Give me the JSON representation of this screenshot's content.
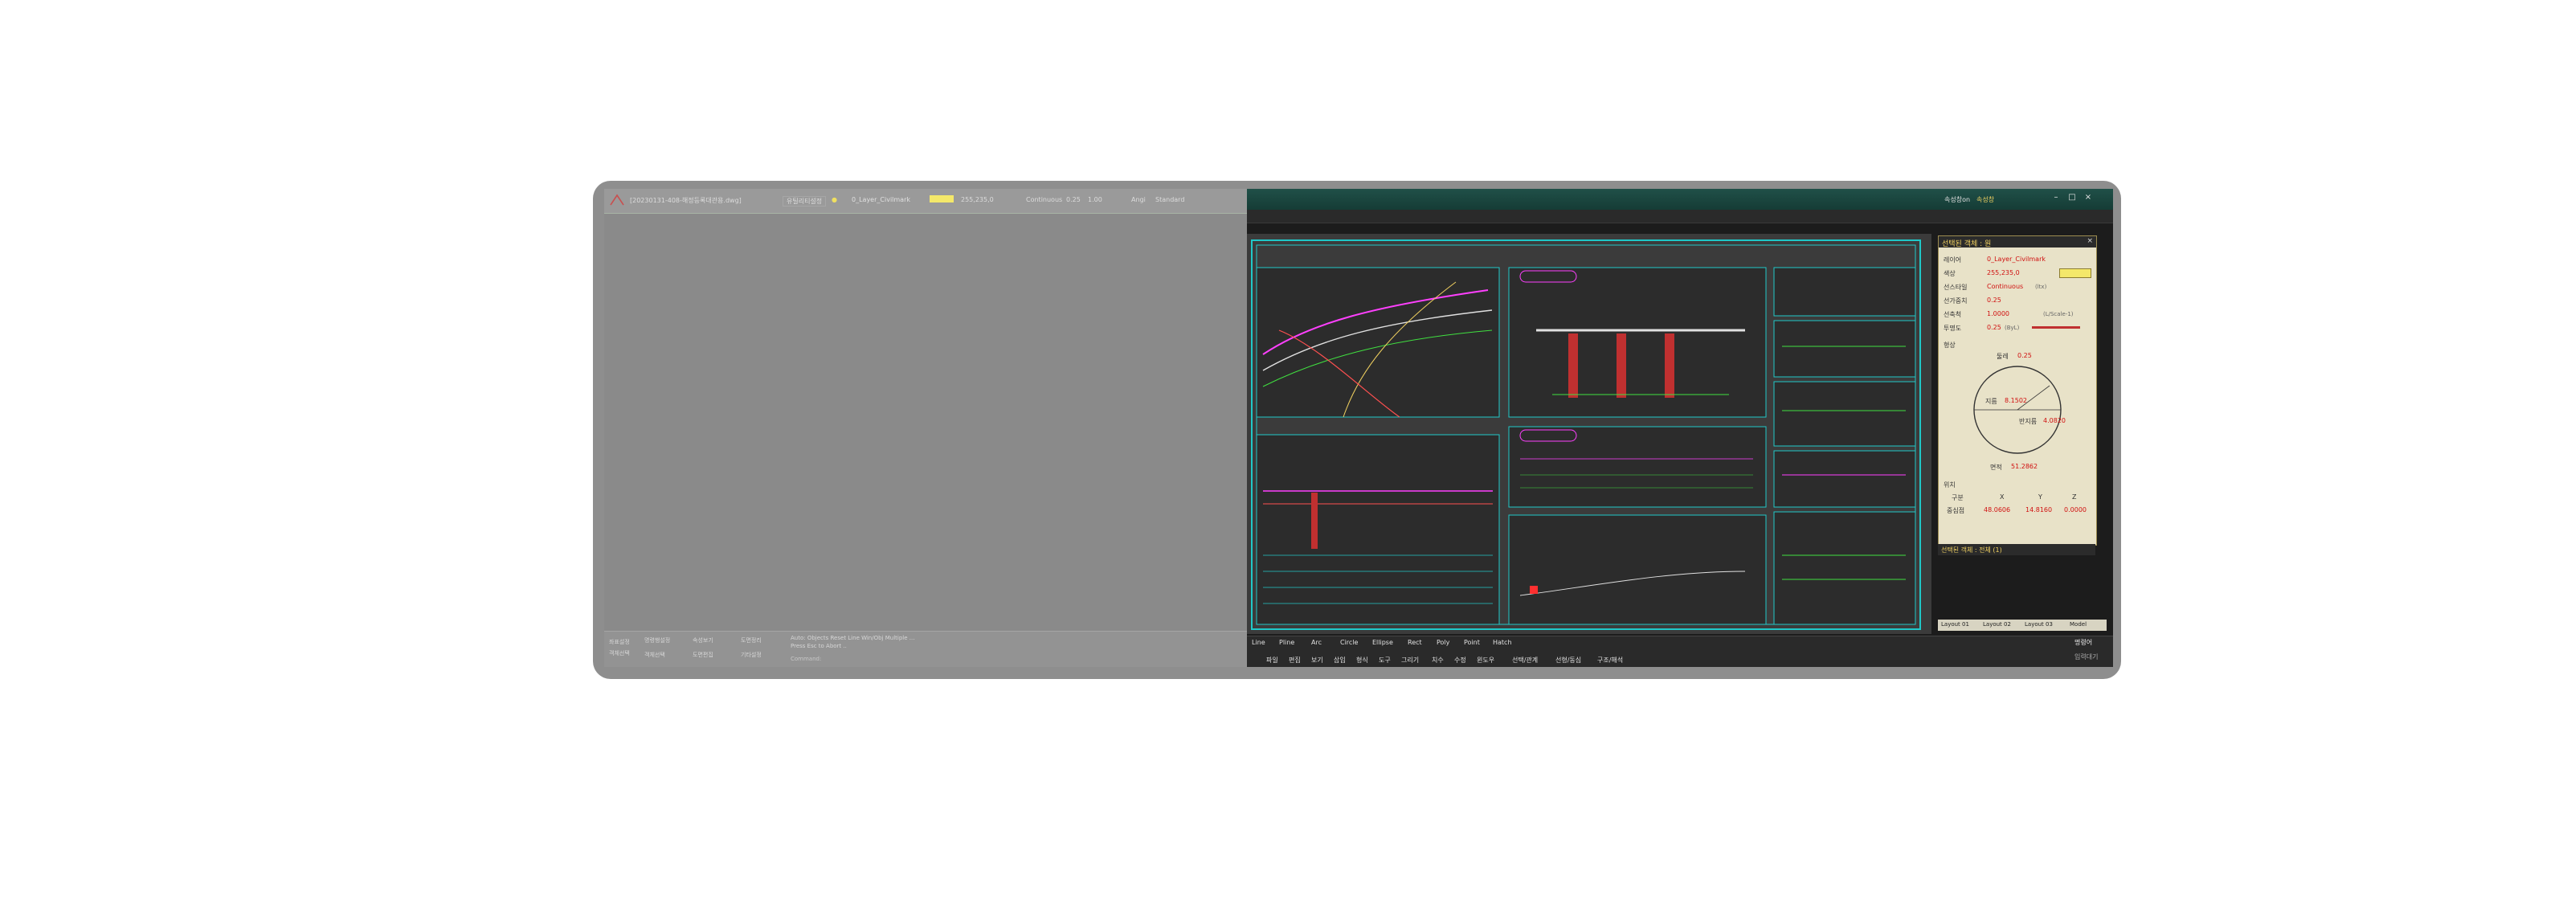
{
  "colors": {
    "accent": "#20c8c8",
    "highlight": "#ff40ff",
    "value_red": "#d01010",
    "swatch": "#f4e86a"
  },
  "left_panel": {
    "title": "[20230131-408-해정등록대관용.dwg]",
    "breadcrumb_tab": "유틸리티설정",
    "layer_name": "0_Layer_Civilmark",
    "color_value": "255,235,0",
    "linetype_name": "Continuous",
    "line_weight": "0.25",
    "line_scale": "1.00",
    "text_style_label": "Angi",
    "text_style": "Standard",
    "cmd_left_top": "좌표설정",
    "cmd_left_bottom": "객체선택",
    "cmd_buttons_row1": [
      "명령행설정",
      "속성보기",
      "도면정리"
    ],
    "cmd_buttons_row2": [
      "객체선택",
      "도면편집",
      "기타설정"
    ],
    "cmd_log": [
      "Auto: Objects Reset Line Win/Obj Multiple ...",
      "Press Esc to Abort .."
    ],
    "cmd_prompt": "Command:"
  },
  "right_panel": {
    "title_btn1": "속성창on",
    "title_btn2": "속성창",
    "props_header": "선택된 객체 : 원",
    "props": [
      {
        "label": "레이어",
        "value": "0_Layer_Civilmark"
      },
      {
        "label": "색상",
        "value": "255,235,0"
      },
      {
        "label": "선스타일",
        "value": "Continuous",
        "sub": "(ltx)"
      },
      {
        "label": "선가중치",
        "value": "0.25"
      },
      {
        "label": "선축척",
        "value": "1.0000",
        "sub": "(L/Scale-1)"
      },
      {
        "label": "투명도",
        "value": "0.25",
        "sub": "(ByL)"
      }
    ],
    "shape_label": "형상",
    "circle": {
      "diameter_label": "둘레",
      "diameter": "0.25",
      "radius_label": "지름",
      "radius": "8.1502",
      "r2_label": "반지름",
      "r2": "4.0820",
      "area_label": "면적",
      "area": "51.2862"
    },
    "position_label": "위치",
    "position_headers": [
      "구분",
      "X",
      "Y",
      "Z"
    ],
    "position_row": {
      "label": "중심점",
      "x": "48.0606",
      "y": "14.8160",
      "z": "0.0000"
    },
    "footer": "선택된 객체 : 전체 (1)",
    "layout_tabs": [
      "Layout 01",
      "Layout 02",
      "Layout 03",
      "Model"
    ],
    "tools": [
      "Line",
      "Pline",
      "Arc",
      "Circle",
      "Ellipse",
      "Rect",
      "Poly",
      "Point",
      "Hatch"
    ],
    "menus": [
      "파일",
      "편집",
      "보기",
      "삽입",
      "형식",
      "도구",
      "그리기",
      "치수",
      "수정",
      "윈도우",
      "선택/관계",
      "선형/동심",
      "구조/해석"
    ],
    "corner_label": "명령어",
    "corner_sub": "입력대기"
  }
}
